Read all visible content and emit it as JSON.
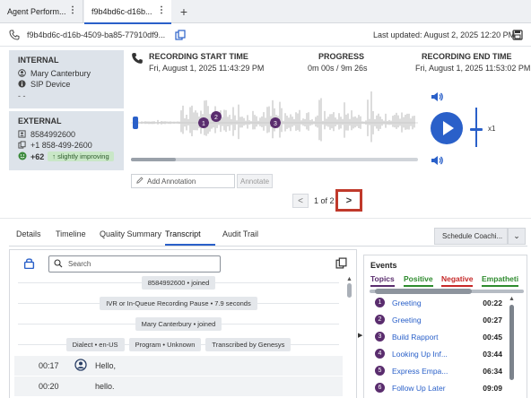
{
  "tabs": [
    {
      "label": "Agent Perform..."
    },
    {
      "label": "f9b4bd6c-d16b..."
    }
  ],
  "tab_add_label": "+",
  "conversation": {
    "id": "f9b4bd6c-d16b-4509-ba85-77910df9...",
    "last_updated": "Last updated: August 2, 2025 12:20 PM"
  },
  "internal": {
    "header": "INTERNAL",
    "name": "Mary Canterbury",
    "device": "SIP Device",
    "extra": "- -"
  },
  "external": {
    "header": "EXTERNAL",
    "ani": "8584992600",
    "phone": "+1 858-499-2600",
    "sentiment_score": "+62",
    "sentiment_trend": "slightly improving"
  },
  "recording": {
    "start_label": "RECORDING START TIME",
    "start_time": "Fri, August 1, 2025 11:43:29 PM",
    "progress_label": "PROGRESS",
    "progress_value": "0m 00s / 9m 26s",
    "end_label": "RECORDING END TIME",
    "end_time": "Fri, August 1, 2025 11:53:02 PM",
    "markers": [
      "1",
      "2",
      "3"
    ],
    "speed": "x1"
  },
  "annotation": {
    "placeholder": "Add Annotation",
    "button": "Annotate"
  },
  "pager": {
    "text": "1 of 2",
    "prev": "<",
    "next": ">"
  },
  "section_tabs": [
    "Details",
    "Timeline",
    "Quality Summary",
    "Transcript",
    "Audit Trail"
  ],
  "active_tab": "Transcript",
  "schedule_button": "Schedule Coachi...",
  "transcript": {
    "search_placeholder": "Search",
    "chips": [
      [
        "8584992600 • joined"
      ],
      [
        "IVR or In-Queue Recording Pause • 7.9 seconds"
      ],
      [
        "Mary Canterbury • joined"
      ],
      [
        "Dialect • en-US",
        "Program • Unknown",
        "Transcribed by Genesys"
      ]
    ],
    "rows": [
      {
        "time": "00:17",
        "text": "Hello,"
      },
      {
        "time": "00:20",
        "text": "hello."
      }
    ]
  },
  "events": {
    "header": "Events",
    "tabs": [
      {
        "label": "Topics",
        "color": "#5a2d6e"
      },
      {
        "label": "Positive",
        "color": "#2e8b2e"
      },
      {
        "label": "Negative",
        "color": "#c62828"
      },
      {
        "label": "Empatheti",
        "color": "#2e8b2e"
      }
    ],
    "items": [
      {
        "n": "1",
        "name": "Greeting",
        "time": "00:22"
      },
      {
        "n": "2",
        "name": "Greeting",
        "time": "00:27"
      },
      {
        "n": "3",
        "name": "Build Rapport",
        "time": "00:45"
      },
      {
        "n": "4",
        "name": "Looking Up Inf...",
        "time": "03:44"
      },
      {
        "n": "5",
        "name": "Express Empa...",
        "time": "06:34"
      },
      {
        "n": "6",
        "name": "Follow Up Later",
        "time": "09:09"
      }
    ]
  },
  "colors": {
    "accent": "#2a60c9",
    "highlight": "#c0392b",
    "topic_marker": "#5a2d6e",
    "sentiment_pill": "#c9e7c7"
  }
}
